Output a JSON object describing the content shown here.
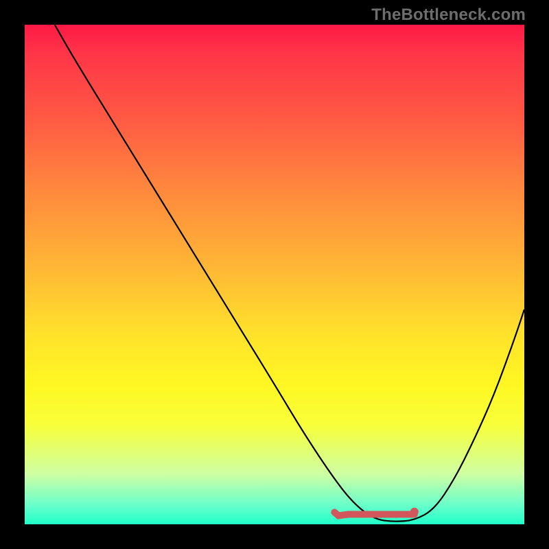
{
  "watermark": "TheBottleneck.com",
  "chart_data": {
    "type": "line",
    "title": "",
    "xlabel": "",
    "ylabel": "",
    "xlim": [
      0,
      100
    ],
    "ylim": [
      0,
      100
    ],
    "grid": false,
    "legend": false,
    "background_gradient": {
      "top": "#ff1a46",
      "mid": "#ffe22b",
      "bottom": "#20ffc9"
    },
    "series": [
      {
        "name": "bottleneck-curve",
        "color": "#000000",
        "x": [
          6,
          10,
          18,
          26,
          34,
          42,
          50,
          56,
          62,
          66,
          70,
          74,
          78,
          82,
          86,
          90,
          94,
          98,
          100
        ],
        "values": [
          100,
          93,
          80,
          67,
          54,
          41,
          28,
          18,
          9,
          4,
          1,
          0.5,
          0.8,
          3,
          9,
          17,
          26,
          37,
          43
        ]
      }
    ],
    "markers": [
      {
        "name": "optimal-range",
        "type": "range",
        "color": "#d2575c",
        "x_start": 62,
        "x_end": 78,
        "y": 2
      },
      {
        "name": "optimal-point",
        "type": "point",
        "color": "#d2575c",
        "x": 78,
        "y": 2.5
      }
    ]
  }
}
